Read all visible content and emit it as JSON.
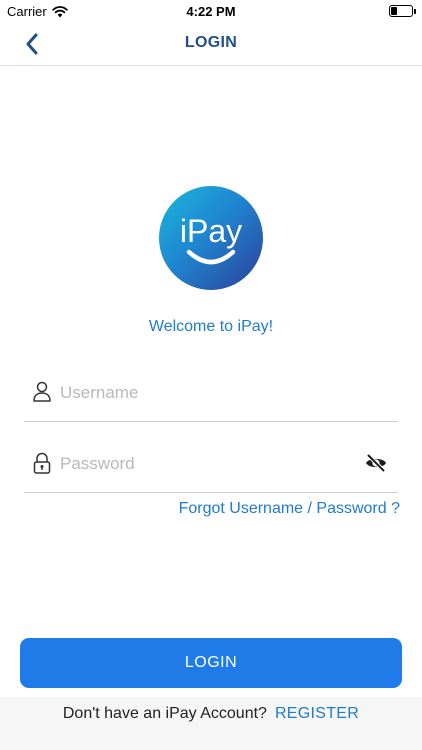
{
  "status_bar": {
    "carrier": "Carrier",
    "time": "4:22 PM",
    "icons": [
      "wifi-icon",
      "battery-icon"
    ]
  },
  "nav": {
    "title": "LOGIN",
    "back_icon": "chevron-left-icon"
  },
  "logo": {
    "text": "iPay",
    "colors": [
      "#1bb8dc",
      "#1f86d0",
      "#2c3f99"
    ]
  },
  "welcome_text": "Welcome to iPay!",
  "form": {
    "username": {
      "placeholder": "Username",
      "value": "",
      "icon": "user-icon"
    },
    "password": {
      "placeholder": "Password",
      "value": "",
      "icon": "lock-icon",
      "toggle_icon": "eye-off-icon"
    },
    "forgot_link": "Forgot Username / Password ?"
  },
  "login_button": "LOGIN",
  "register": {
    "text": "Don't have an iPay Account?",
    "link": "REGISTER"
  },
  "colors": {
    "accent": "#1d7bd0",
    "button": "#1e7be8",
    "nav_title": "#1e4f8a"
  }
}
